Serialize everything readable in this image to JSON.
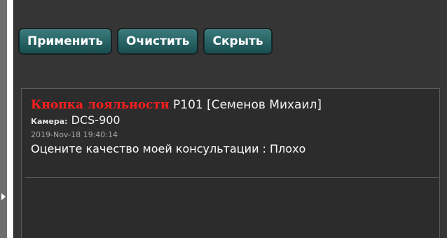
{
  "toolbar": {
    "apply_label": "Применить",
    "clear_label": "Очистить",
    "hide_label": "Скрыть"
  },
  "events": [
    {
      "type": "Кнопка лояльности",
      "source": " P101 [Семенов Михаил]",
      "camera_label": "Камера:",
      "camera_value": " DCS-900",
      "timestamp": "2019-Nov-18 19:40:14",
      "message": "Оцените качество моей консультации : Плохо"
    }
  ],
  "colors": {
    "panel_bg": "#353535",
    "button_bg": "#286264",
    "event_type": "#ff1e1e"
  },
  "icons": {
    "collapse": "triangle-right"
  }
}
